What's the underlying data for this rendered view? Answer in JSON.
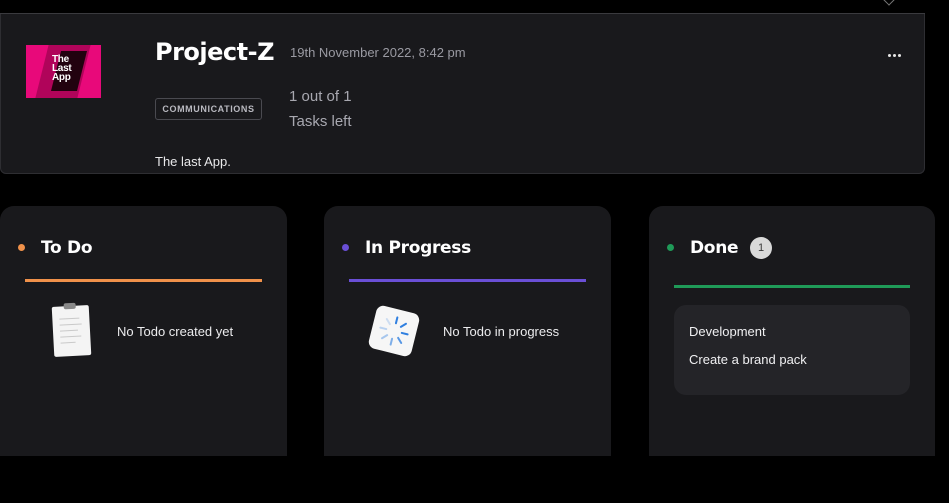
{
  "project": {
    "logo_text": "The Last App",
    "title": "Project-Z",
    "date": "19th November 2022, 8:42 pm",
    "tag": "COMMUNICATIONS",
    "tasks_count": "1 out of 1",
    "tasks_label": "Tasks left",
    "description": "The last App.",
    "more_icon": "more-horizontal-icon",
    "brand_color": "#e8097a"
  },
  "board": {
    "columns": [
      {
        "title": "To Do",
        "accent": "#f0914a",
        "empty_text": "No Todo created yet",
        "empty_icon": "clipboard-icon"
      },
      {
        "title": "In Progress",
        "accent": "#6a4fd6",
        "empty_text": "No Todo in progress",
        "empty_icon": "loading-spinner-icon"
      },
      {
        "title": "Done",
        "accent": "#1f9a58",
        "count": "1",
        "cards": [
          {
            "category": "Development",
            "title": "Create a brand pack"
          }
        ]
      }
    ]
  }
}
